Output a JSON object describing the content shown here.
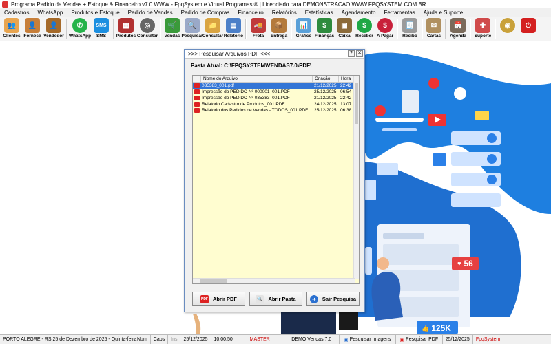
{
  "window": {
    "title": "Programa Pedido de Vendas + Estoque & Financeiro v7.0 WWW - FpqSystem e Virtual Programas ® | Licenciado para  DEMONSTRACAO WWW.FPQSYSTEM.COM.BR"
  },
  "menu": [
    "Cadastros",
    "WhatsApp",
    "Produtos e Estoque",
    "Pedido de Vendas",
    "Pedido de Compras",
    "Financeiro",
    "Relatórios",
    "Estatísticas",
    "Agendamento",
    "Ferramentas",
    "Ajuda e Suporte"
  ],
  "toolbar": {
    "clientes": "Clientes",
    "fornece": "Fornece",
    "vendedor": "Vendedor",
    "whatsapp": "WhatsApp",
    "sms": "SMS",
    "sms_icon": "SMS",
    "produtos": "Produtos",
    "consultar": "Consultar",
    "vendas": "Vendas",
    "pesquisar": "Pesquisar",
    "consultar2": "Consultar",
    "relatorio": "Relatório",
    "frota": "Frota",
    "entrega": "Entrega",
    "grafico": "Gráfico",
    "financas": "Finanças",
    "caixa": "Caixa",
    "receber": "Receber",
    "apagar": "A Pagar",
    "recibo": "Recibo",
    "cartas": "Cartas",
    "agenda": "Agenda",
    "suporte": "Suporte"
  },
  "dialog": {
    "title": ">>> Pesquisar Arquivos PDF <<<",
    "path_label": "Pasta Atual: C:\\FPQSYSTEM\\VENDAS7.0\\PDF\\",
    "columns": {
      "name": "Nome do Arquivo",
      "created": "Criação",
      "time": "Hora"
    },
    "files": [
      {
        "name": "035383_001.pdf",
        "created": "21/12/2025",
        "time": "22:42"
      },
      {
        "name": "Impressão do PEDIDO Nº 000001_001.PDF",
        "created": "25/12/2025",
        "time": "06:54"
      },
      {
        "name": "Impressão do PEDIDO Nº 035383_001.PDF",
        "created": "21/12/2025",
        "time": "22:42"
      },
      {
        "name": "Relatorio Cadastro de Produtos_001.PDF",
        "created": "24/12/2025",
        "time": "13:07"
      },
      {
        "name": "Relatorio dos Pedidos de Vendas  - TODOS_001.PDF",
        "created": "25/12/2025",
        "time": "06:38"
      }
    ],
    "buttons": {
      "open_pdf": "Abrir PDF",
      "open_folder": "Abrir Pasta",
      "exit": "Sair Pesquisa",
      "pdf_icon": "PDF"
    }
  },
  "desktop": {
    "likes": "56",
    "followers": "125K"
  },
  "status": {
    "location": "PORTO ALEGRE - RS 25 de Dezembro de 2025 - Quinta-feira",
    "num": "Num",
    "caps": "Caps",
    "ins": "Ins",
    "date": "25/12/2025",
    "time": "10:00:50",
    "user": "MASTER",
    "demo": "DEMO Vendas 7.0",
    "img": "Pesquisar Imagens",
    "pdf": "Pesquisar PDF",
    "date2": "25/12/2025",
    "brand": "FpqSystem"
  },
  "colors": {
    "accent": "#3375d6",
    "list_bg": "#fffdd0",
    "illustration": "#1e7fe0"
  }
}
